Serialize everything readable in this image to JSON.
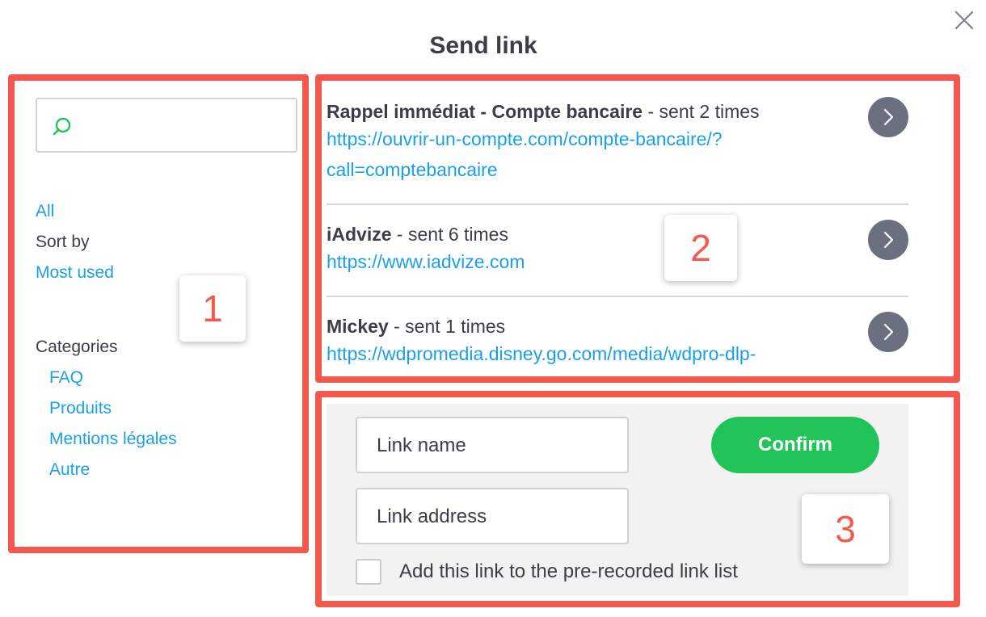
{
  "dialog": {
    "title": "Send link"
  },
  "sidebar": {
    "search_placeholder": "",
    "all_label": "All",
    "sort_by_label": "Sort by",
    "most_used_label": "Most used",
    "categories_label": "Categories",
    "categories": [
      "FAQ",
      "Produits",
      "Mentions légales",
      "Autre"
    ]
  },
  "links": [
    {
      "name": "Rappel immédiat - Compte bancaire",
      "count": " - sent 2 times",
      "url_line1": "https://ouvrir-un-compte.com/compte-bancaire/?",
      "url_line2": "call=comptebancaire"
    },
    {
      "name": "iAdvize",
      "count": " - sent 6 times",
      "url_line1": "https://www.iadvize.com"
    },
    {
      "name": "Mickey",
      "count": " - sent 1 times",
      "url_line1": "https://wdpromedia.disney.go.com/media/wdpro-dlp-"
    }
  ],
  "form": {
    "name_placeholder": "Link name",
    "address_placeholder": "Link address",
    "confirm_label": "Confirm",
    "checkbox_label": "Add this link to the pre-recorded link list"
  },
  "annotations": [
    "1",
    "2",
    "3"
  ],
  "colors": {
    "accent_blue": "#1aa0e8",
    "confirm_green": "#22c45a",
    "annotation_red": "#f5594d",
    "arrow_button": "#6b7080"
  },
  "icons": [
    "close-icon",
    "search-icon",
    "chevron-right-icon"
  ]
}
